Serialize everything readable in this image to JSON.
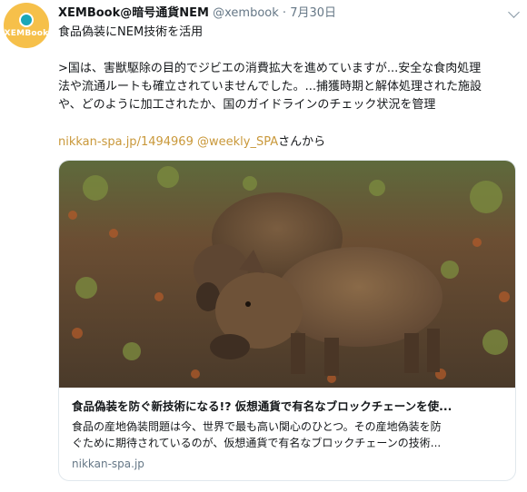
{
  "tweet": {
    "avatar_text": "XEMBook",
    "display_name": "XEMBook@暗号通貨NEM",
    "handle": "@xembook",
    "separator": "·",
    "time": "7月30日",
    "line1": "食品偽装にNEM技術を活用",
    "body_lines": [
      ">国は、害獣駆除の目的でジビエの消費拡大を進めていますが...安全な食肉処理",
      "法や流通ルートも確立されていませんでした。...捕獲時期と解体処理された施設",
      "や、どのように加工されたか、国のガイドラインのチェック状況を管理"
    ],
    "link_url": "nikkan-spa.jp/1494969",
    "link_mention": "@weekly_SPA",
    "link_suffix": "さんから"
  },
  "card": {
    "title": "食品偽装を防ぐ新技術になる!? 仮想通貨で有名なブロックチェーンを使...",
    "desc_lines": [
      "食品の産地偽装問題は今、世界で最も高い関心のひとつ。その産地偽装を防",
      "ぐために期待されているのが、仮想通貨で有名なブロックチェーンの技術..."
    ],
    "domain": "nikkan-spa.jp"
  },
  "colors": {
    "accent": "#c9983a",
    "avatar_bg": "#f6c04a",
    "muted": "#657786",
    "border": "#e1e8ed"
  }
}
